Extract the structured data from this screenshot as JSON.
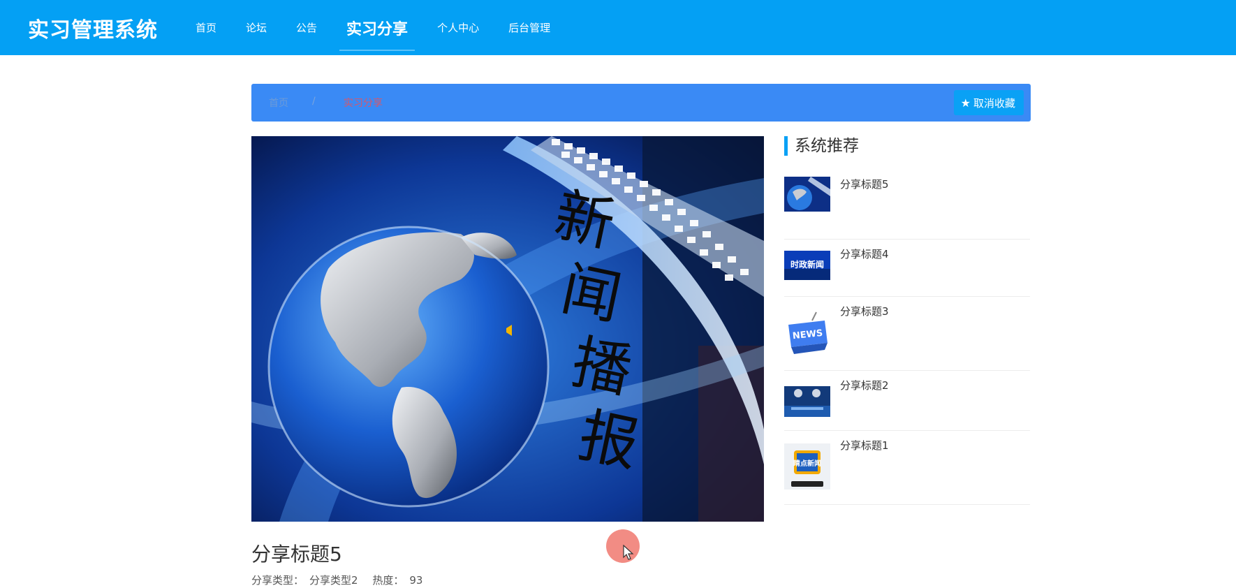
{
  "app": {
    "title": "实习管理系统"
  },
  "nav": {
    "items": [
      {
        "label": "首页",
        "active": false
      },
      {
        "label": "论坛",
        "active": false
      },
      {
        "label": "公告",
        "active": false
      },
      {
        "label": "实习分享",
        "active": true
      },
      {
        "label": "个人中心",
        "active": false
      },
      {
        "label": "后台管理",
        "active": false
      }
    ]
  },
  "breadcrumb": {
    "home": "首页",
    "separator": "/",
    "current": "实习分享"
  },
  "favorite_button": {
    "label": "取消收藏",
    "icon": "star-icon"
  },
  "hero": {
    "text": "新闻播报"
  },
  "article": {
    "title": "分享标题5",
    "type_label": "分享类型：",
    "type_value": "分享类型2",
    "heat_label": "热度：",
    "heat_value": "93"
  },
  "sidebar": {
    "heading": "系统推荐",
    "items": [
      {
        "title": "分享标题5"
      },
      {
        "title": "分享标题4",
        "thumb_text": "时政新闻"
      },
      {
        "title": "分享标题3",
        "thumb_text": "NEWS"
      },
      {
        "title": "分享标题2"
      },
      {
        "title": "分享标题1",
        "thumb_text": "睛点新闻"
      }
    ]
  },
  "colors": {
    "header": "#04a0f4",
    "breadcrumb": "#3a8af5",
    "accent": "#0aa1f5"
  }
}
